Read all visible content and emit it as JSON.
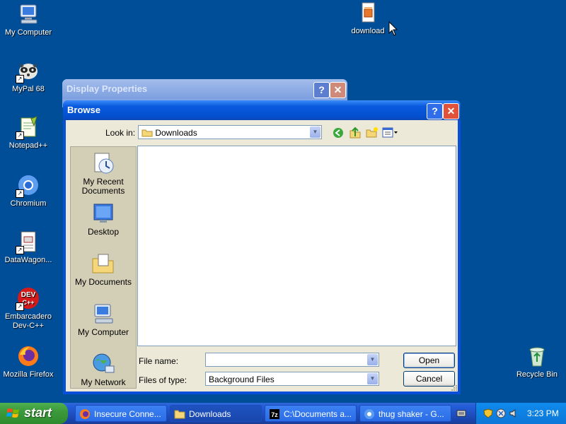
{
  "desktop": {
    "icons": [
      {
        "label": "My Computer"
      },
      {
        "label": "MyPal 68"
      },
      {
        "label": "Notepad++"
      },
      {
        "label": "Chromium"
      },
      {
        "label": "DataWagon..."
      },
      {
        "label": "Embarcadero Dev-C++"
      },
      {
        "label": "Mozilla Firefox"
      },
      {
        "label": "download"
      },
      {
        "label": "Recycle Bin"
      }
    ]
  },
  "display_properties": {
    "title": "Display Properties",
    "help_glyph": "?",
    "close_glyph": "✕"
  },
  "browse": {
    "title": "Browse",
    "help_glyph": "?",
    "close_glyph": "✕",
    "look_in_label": "Look in:",
    "look_in_value": "Downloads",
    "places": [
      {
        "label": "My Recent Documents"
      },
      {
        "label": "Desktop"
      },
      {
        "label": "My Documents"
      },
      {
        "label": "My Computer"
      },
      {
        "label": "My Network"
      }
    ],
    "file_name_label": "File name:",
    "file_name_value": "",
    "files_of_type_label": "Files of type:",
    "files_of_type_value": "Background Files",
    "open_label": "Open",
    "cancel_label": "Cancel"
  },
  "taskbar": {
    "start_label": "start",
    "tasks": [
      {
        "label": "Insecure Conne..."
      },
      {
        "label": "Downloads"
      },
      {
        "label": "C:\\Documents a..."
      },
      {
        "label": "thug shaker - G..."
      }
    ],
    "clock": "3:23 PM"
  },
  "colors": {
    "desktop": "#004e98",
    "title_active": "#0a5adf",
    "title_inactive": "#7b9ee3",
    "start_green": "#3c9a3c",
    "dialog_bg": "#ece9d8"
  }
}
